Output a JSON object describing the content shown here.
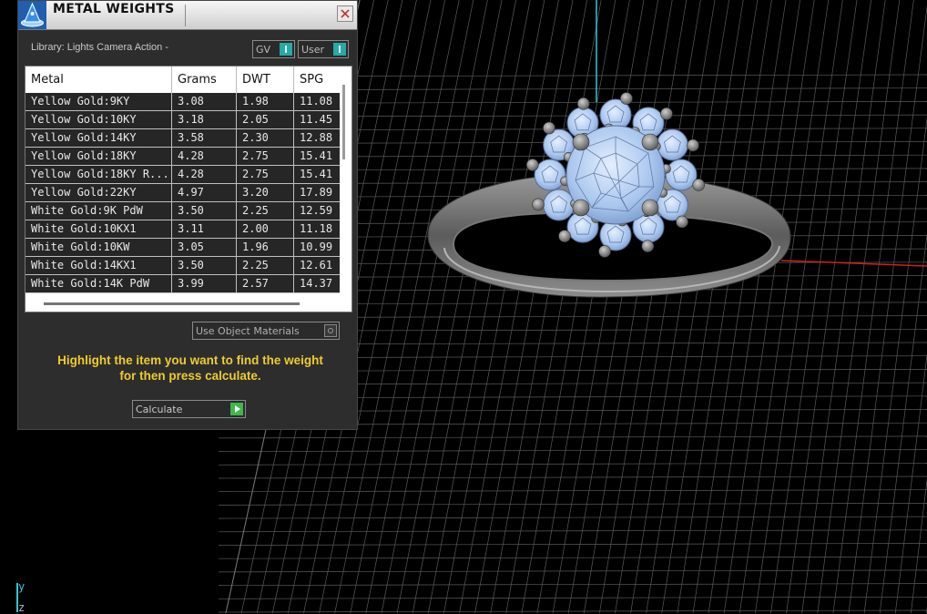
{
  "panel": {
    "title": "METAL WEIGHTS",
    "close_label": "✕",
    "library_label": "Library: Lights Camera Action -",
    "toggles": [
      {
        "label": "GV"
      },
      {
        "label": "User"
      }
    ],
    "table": {
      "headers": [
        "Metal",
        "Grams",
        "DWT",
        "SPG"
      ],
      "rows": [
        [
          "Yellow Gold:9KY",
          "3.08",
          "1.98",
          "11.08"
        ],
        [
          "Yellow Gold:10KY",
          "3.18",
          "2.05",
          "11.45"
        ],
        [
          "Yellow Gold:14KY",
          "3.58",
          "2.30",
          "12.88"
        ],
        [
          "Yellow Gold:18KY",
          "4.28",
          "2.75",
          "15.41"
        ],
        [
          "Yellow Gold:18KY R...",
          "4.28",
          "2.75",
          "15.41"
        ],
        [
          "Yellow Gold:22KY",
          "4.97",
          "3.20",
          "17.89"
        ],
        [
          "White Gold:9K PdW",
          "3.50",
          "2.25",
          "12.59"
        ],
        [
          "White Gold:10KX1",
          "3.11",
          "2.00",
          "11.18"
        ],
        [
          "White Gold:10KW",
          "3.05",
          "1.96",
          "10.99"
        ],
        [
          "White Gold:14KX1",
          "3.50",
          "2.25",
          "12.61"
        ],
        [
          "White Gold:14K PdW",
          "3.99",
          "2.57",
          "14.37"
        ]
      ]
    },
    "use_object_materials_label": "Use Object Materials",
    "instruction_line1": "Highlight the item you want to find the weight",
    "instruction_line2": "for then press calculate.",
    "calculate_label": "Calculate"
  },
  "viewport": {
    "axis_y_label": "y",
    "axis_z_label": "z"
  },
  "colors": {
    "accent_toggle": "#2aa7a7",
    "calculate_button": "#3db84a",
    "instruction_text": "#f0cc2a",
    "y_axis": "#2ec8d8",
    "x_axis": "#d02020",
    "gem_blue": "#a9c6ee"
  },
  "icons": {
    "app_logo": "matrix-wizard-hat-icon",
    "close": "close-icon",
    "toggle": "toggle-icon",
    "radio": "radio-icon",
    "play": "play-arrow-icon"
  }
}
